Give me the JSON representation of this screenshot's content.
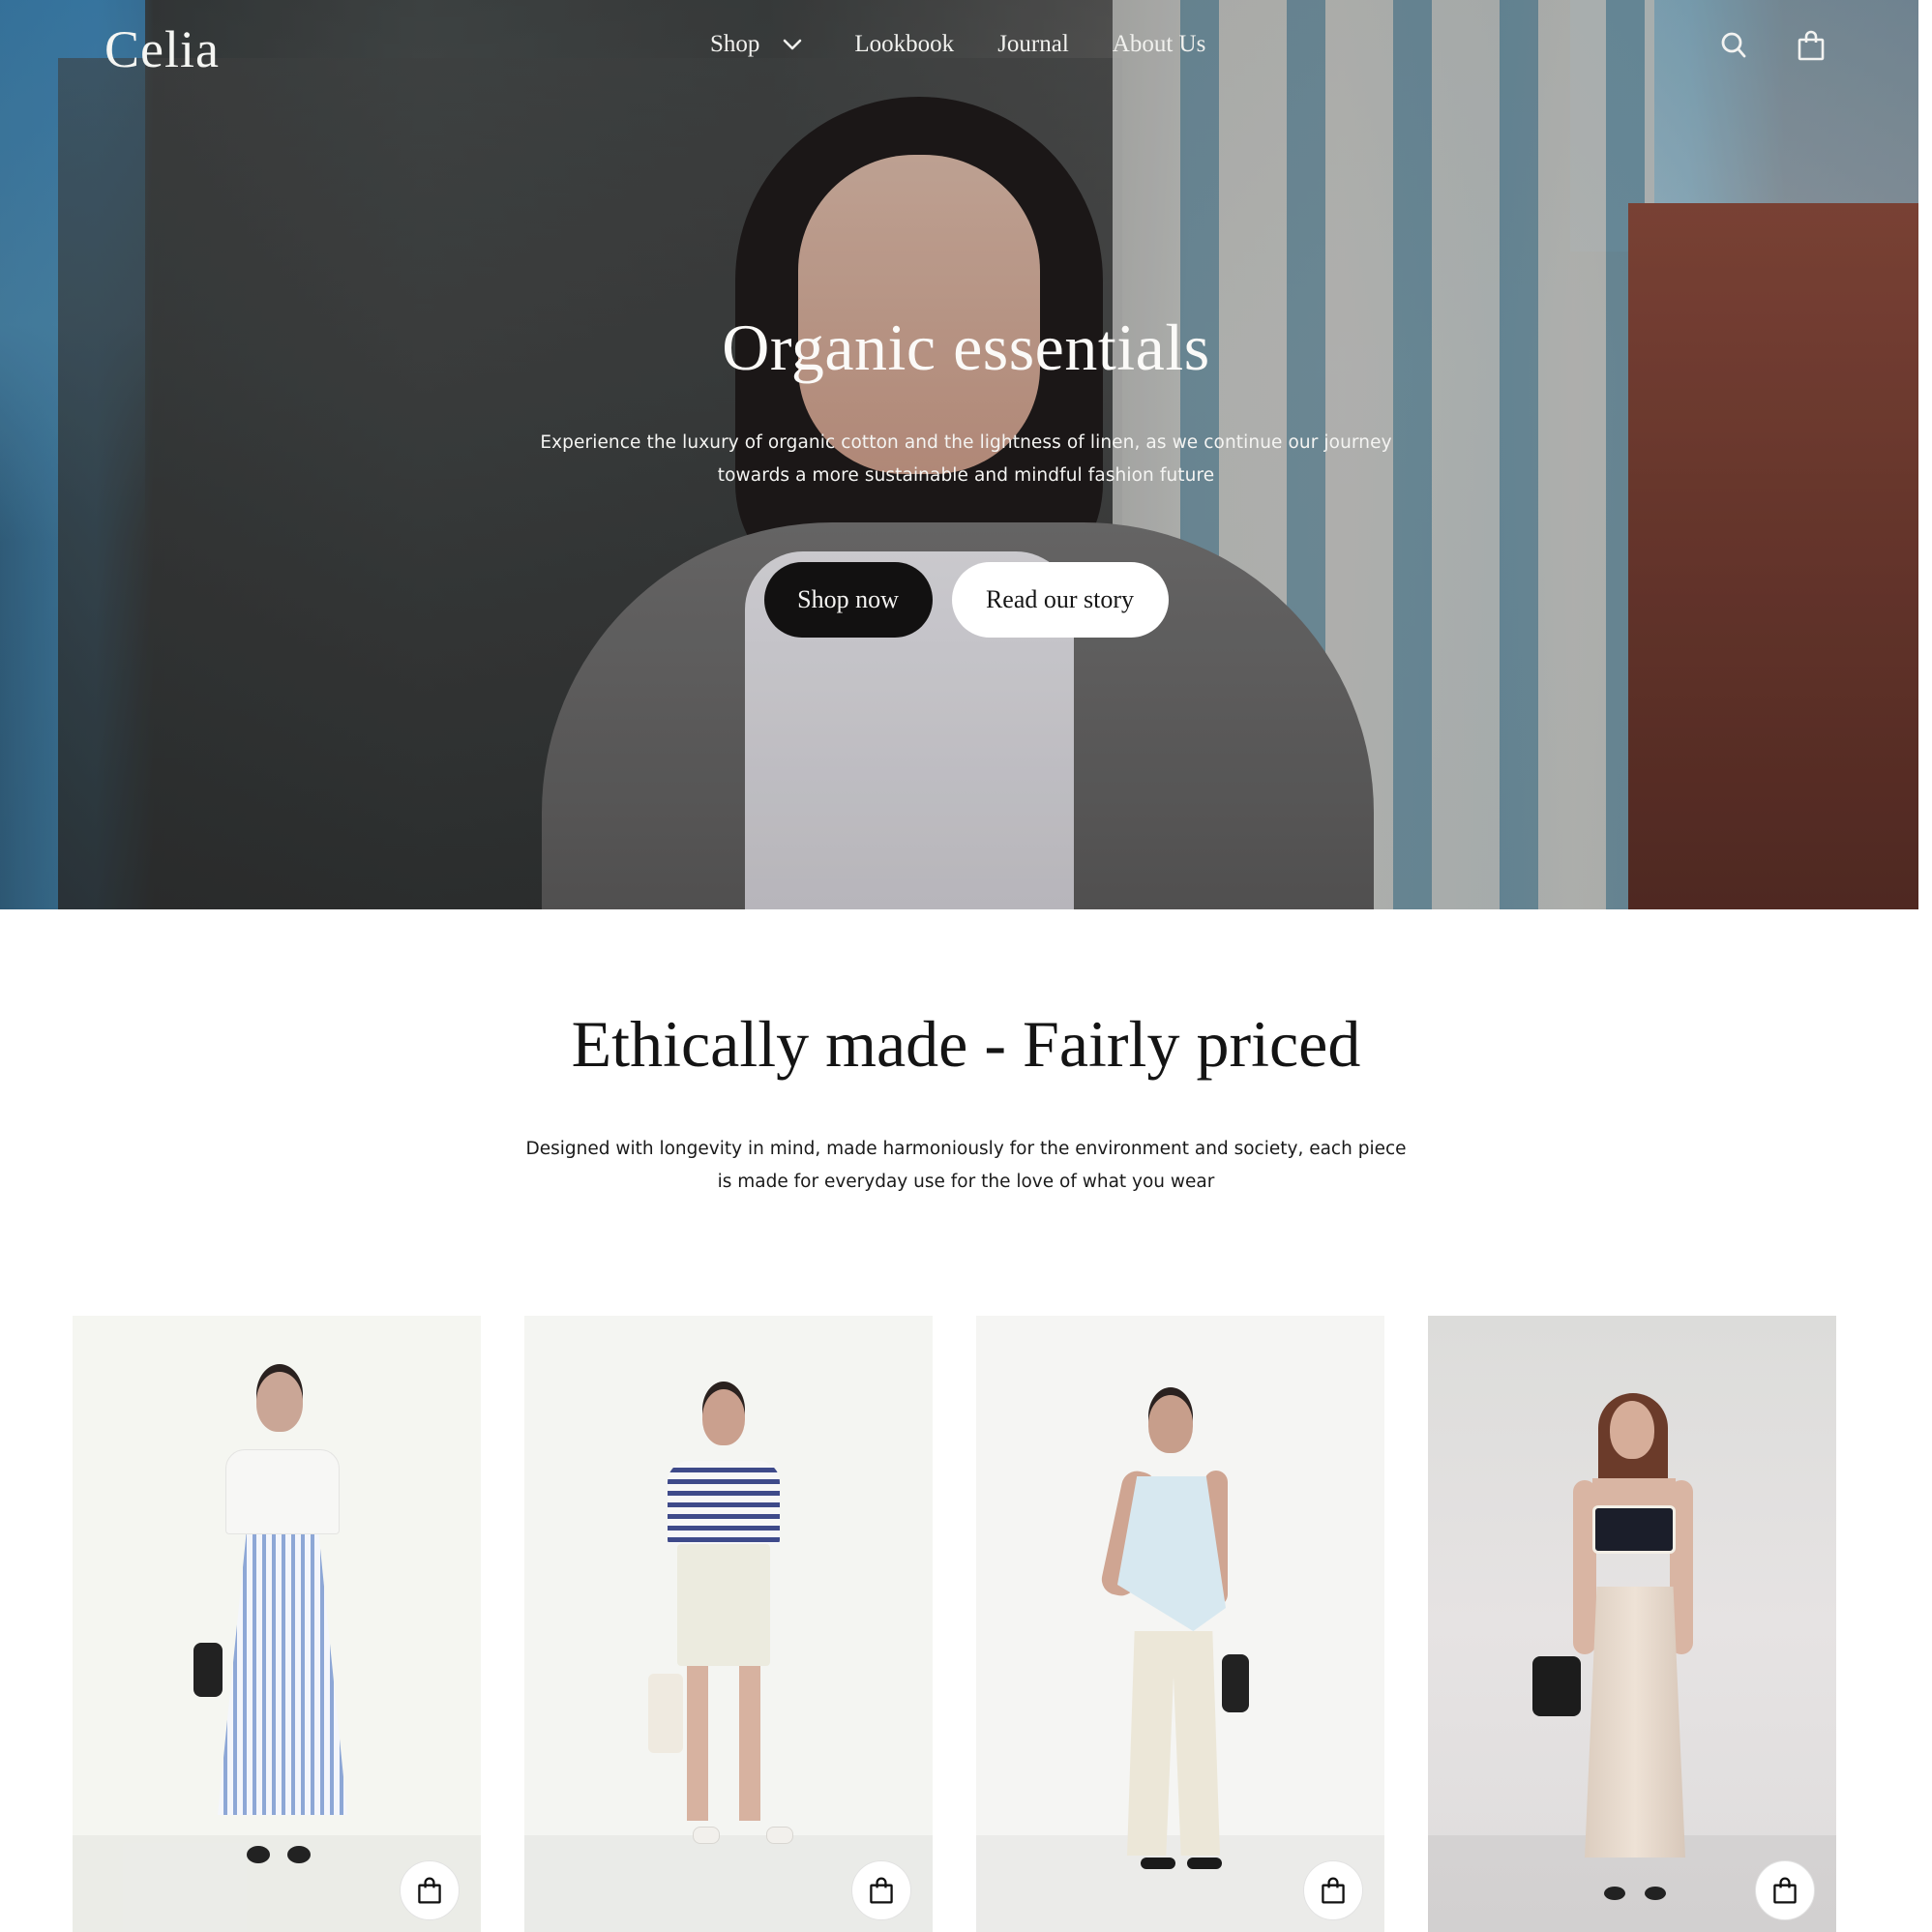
{
  "brand": {
    "logo": "Celia"
  },
  "nav": {
    "links": [
      {
        "label": "Shop",
        "has_dropdown": true,
        "icon": "chevron-down-icon"
      },
      {
        "label": "Lookbook"
      },
      {
        "label": "Journal"
      },
      {
        "label": "About Us"
      }
    ],
    "icons": [
      "search-icon",
      "shopping-bag-icon"
    ]
  },
  "hero": {
    "title": "Organic essentials",
    "subtitle_line1": "Experience the luxury of organic cotton and the lightness of linen, as we continue our journey",
    "subtitle_line2": "towards a more sustainable and mindful fashion future",
    "primary_button": "Shop now",
    "secondary_button": "Read our story",
    "image_alt": "Woman in grey coat and white top in front of buildings"
  },
  "intro": {
    "title": "Ethically made - Fairly priced",
    "text_line1": "Designed with longevity in mind, made harmoniously for the environment and society, each piece",
    "text_line2": "is made for everyday use for the love of what you wear"
  },
  "products": [
    {
      "description": "White tee with blue striped maxi skirt",
      "cart_icon": "shopping-bag-icon"
    },
    {
      "description": "Navy striped tee with cream mini skirt",
      "cart_icon": "shopping-bag-icon"
    },
    {
      "description": "Light blue strapless top with cream wide-leg pants",
      "cart_icon": "shopping-bag-icon"
    },
    {
      "description": "Black bralette with champagne satin midi skirt",
      "cart_icon": "shopping-bag-icon"
    }
  ],
  "colors": {
    "primary_button_bg": "#121111",
    "secondary_button_bg": "#ffffff",
    "text_dark": "#141414"
  }
}
